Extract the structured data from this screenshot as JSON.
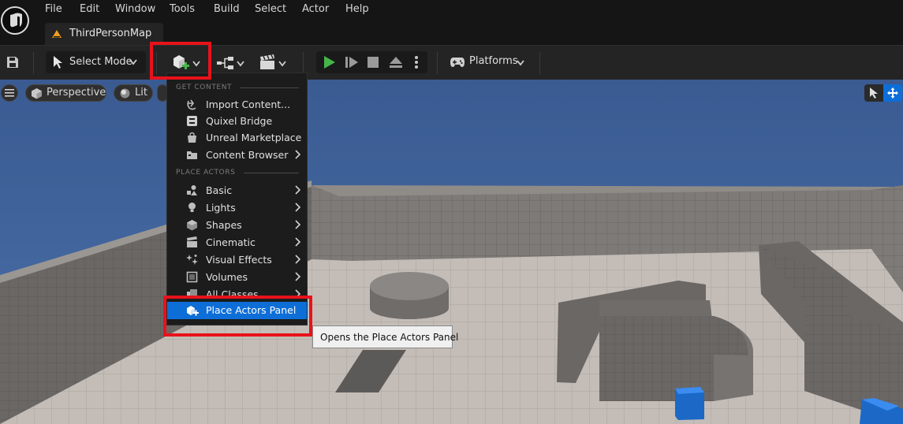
{
  "menu": [
    "File",
    "Edit",
    "Window",
    "Tools",
    "Build",
    "Select",
    "Actor",
    "Help"
  ],
  "tab": {
    "label": "ThirdPersonMap"
  },
  "toolbar": {
    "select_mode": "Select Mode",
    "platforms": "Platforms"
  },
  "viewport": {
    "perspective": "Perspective",
    "lit": "Lit"
  },
  "dropdown": {
    "get_content_header": "GET CONTENT",
    "get_content": [
      {
        "label": "Import Content...",
        "icon": "import-icon",
        "submenu": false
      },
      {
        "label": "Quixel Bridge",
        "icon": "bridge-icon",
        "submenu": false
      },
      {
        "label": "Unreal Marketplace",
        "icon": "marketplace-icon",
        "submenu": false
      },
      {
        "label": "Content Browser",
        "icon": "folder-icon",
        "submenu": true
      }
    ],
    "place_actors_header": "PLACE ACTORS",
    "place_actors": [
      {
        "label": "Basic",
        "icon": "basic-shapes-icon",
        "submenu": true
      },
      {
        "label": "Lights",
        "icon": "lightbulb-icon",
        "submenu": true
      },
      {
        "label": "Shapes",
        "icon": "cube-icon",
        "submenu": true
      },
      {
        "label": "Cinematic",
        "icon": "clapperboard-icon",
        "submenu": true
      },
      {
        "label": "Visual Effects",
        "icon": "sparkle-icon",
        "submenu": true
      },
      {
        "label": "Volumes",
        "icon": "volume-icon",
        "submenu": true
      },
      {
        "label": "All Classes",
        "icon": "classes-icon",
        "submenu": true
      }
    ],
    "highlighted": {
      "label": "Place Actors Panel",
      "icon": "place-actors-icon"
    }
  },
  "tooltip": "Opens the Place Actors Panel",
  "colors": {
    "highlight": "#0d6ed8",
    "callout": "#e8121b",
    "play": "#46b549",
    "sky": "#3c5e95"
  }
}
